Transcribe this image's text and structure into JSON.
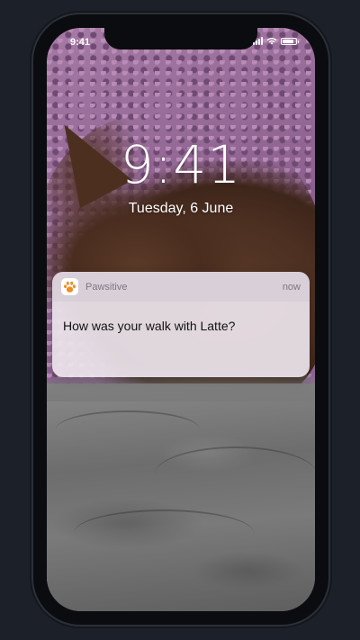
{
  "status_bar": {
    "time": "9:41",
    "battery_level": 0.85
  },
  "lock_screen": {
    "time": "9:41",
    "date": "Tuesday, 6 June"
  },
  "notification": {
    "app_icon": "paw-icon",
    "app_name": "Pawsitive",
    "time": "now",
    "message": "How was your walk with Latte?"
  },
  "colors": {
    "accent": "#f08c1e",
    "notification_background": "#ece4ec"
  }
}
